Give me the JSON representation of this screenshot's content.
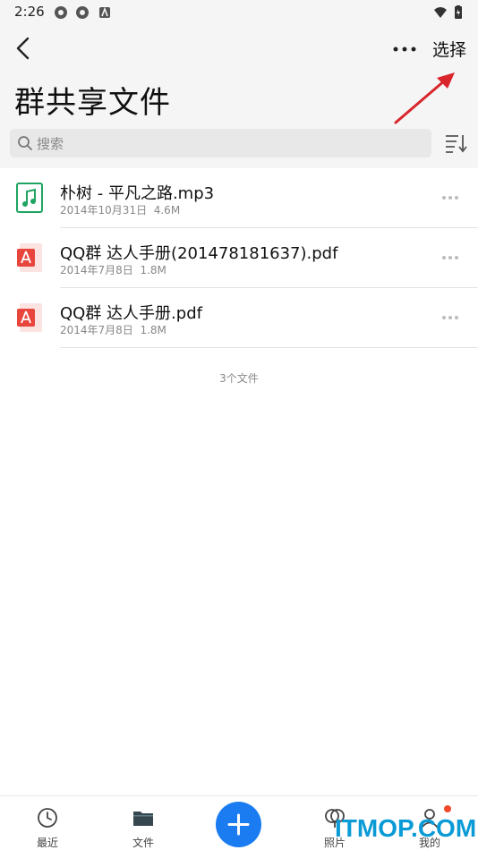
{
  "status_bar": {
    "time": "2:26"
  },
  "header": {
    "title": "群共享文件",
    "select_label": "选择"
  },
  "search": {
    "placeholder": "搜索"
  },
  "files": [
    {
      "name": "朴树 - 平凡之路.mp3",
      "date": "2014年10月31日",
      "size": "4.6M",
      "type": "audio",
      "icon": "music-file-icon"
    },
    {
      "name": "QQ群 达人手册(201478181637).pdf",
      "date": "2014年7月8日",
      "size": "1.8M",
      "type": "pdf",
      "icon": "pdf-file-icon"
    },
    {
      "name": "QQ群 达人手册.pdf",
      "date": "2014年7月8日",
      "size": "1.8M",
      "type": "pdf",
      "icon": "pdf-file-icon"
    }
  ],
  "file_count": "3个文件",
  "tabs": [
    {
      "label": "最近",
      "icon": "clock-icon"
    },
    {
      "label": "文件",
      "icon": "folder-icon"
    },
    {
      "label": "照片",
      "icon": "photo-icon"
    },
    {
      "label": "我的",
      "icon": "person-icon"
    }
  ],
  "watermark": "ITMOP.COM",
  "colors": {
    "accent": "#1a7cf0",
    "badge": "#f2492c",
    "audio_icon": "#1fa462",
    "pdf_icon": "#e8453c",
    "annotation_arrow": "#d8262c"
  }
}
